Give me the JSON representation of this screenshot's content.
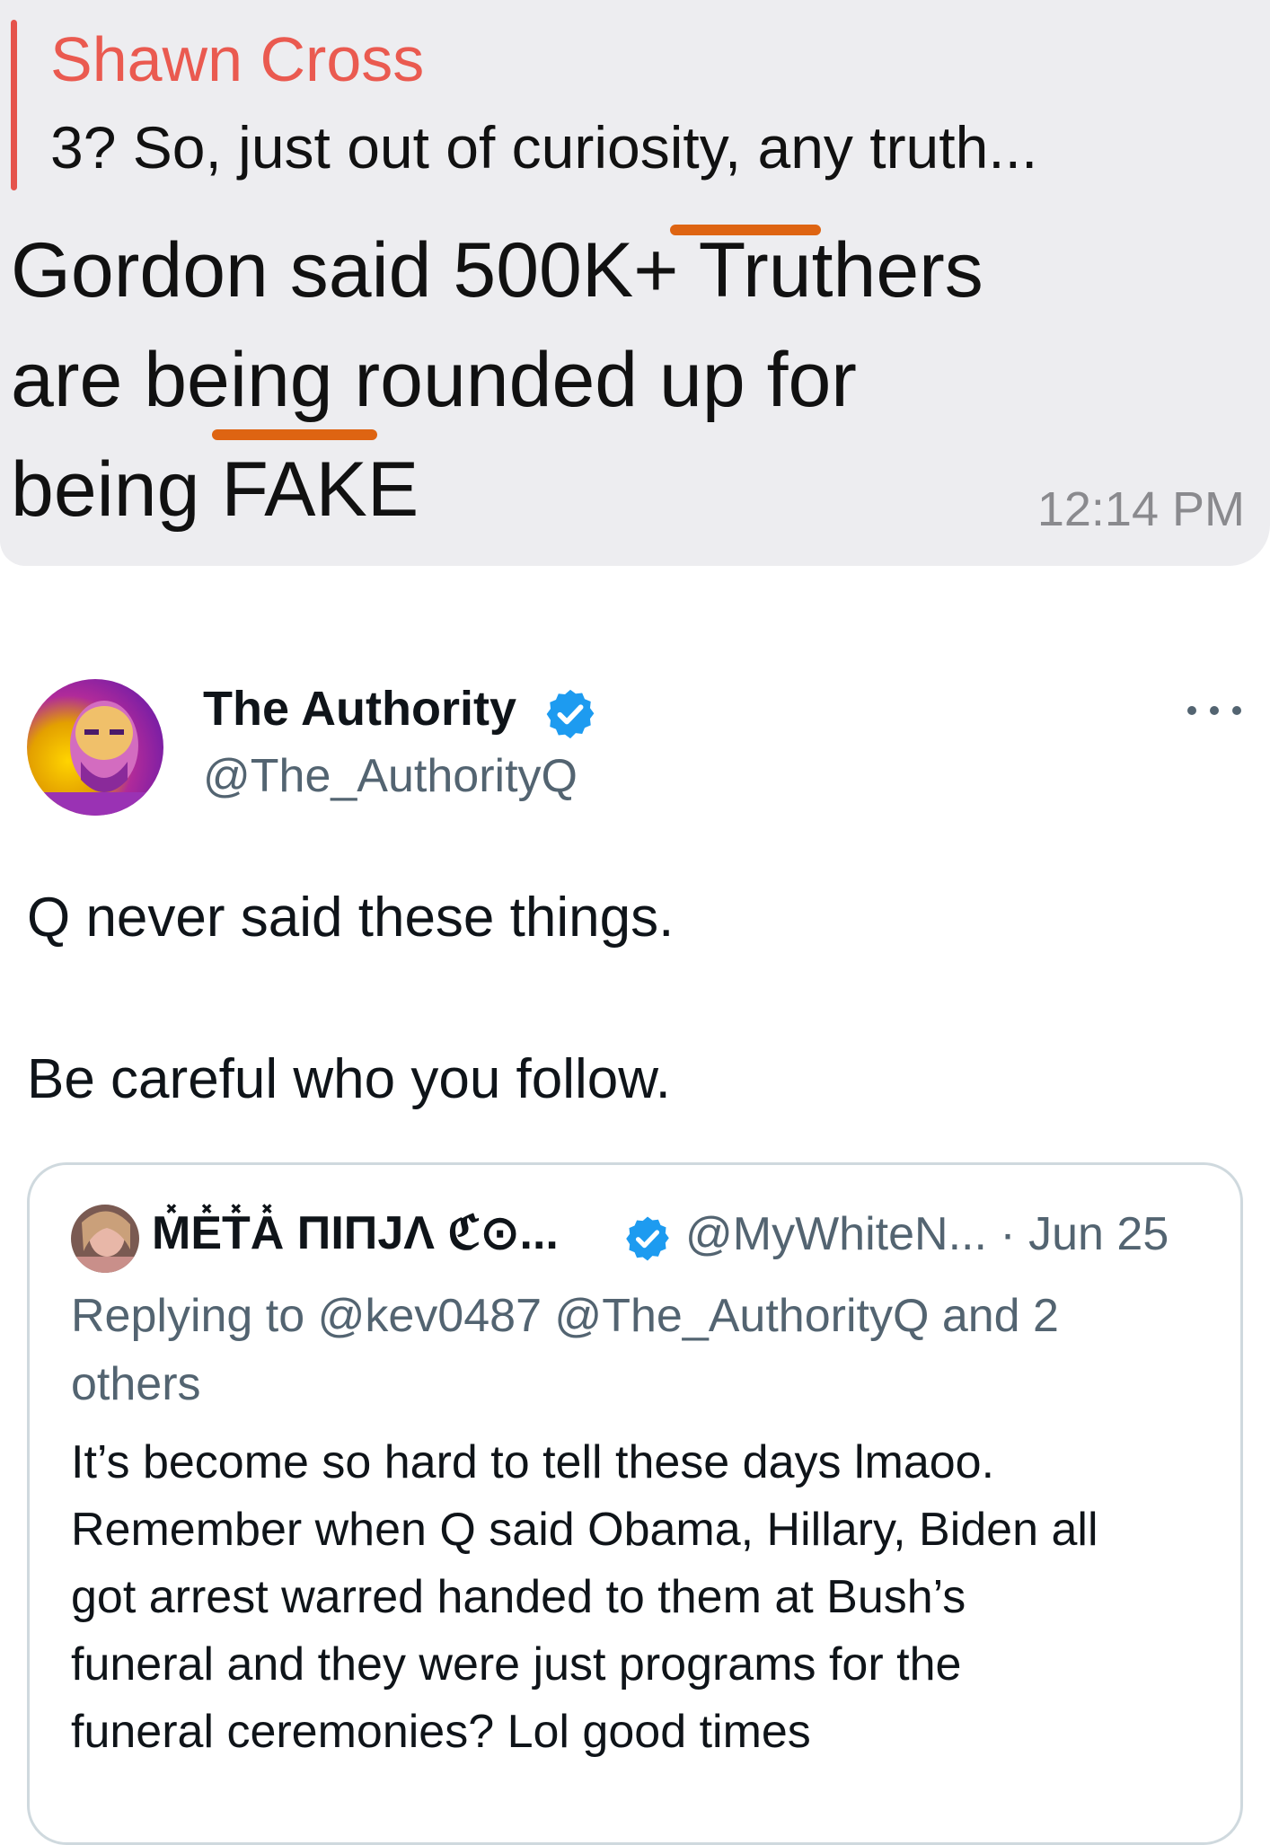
{
  "message": {
    "reply": {
      "sender": "Shawn Cross",
      "snippet": "3? So, just out of curiosity, any truth..."
    },
    "text_lines": [
      "Gordon said 500K+ Truthers",
      "are being rounded up for",
      "being FAKE"
    ],
    "time": "12:14 PM",
    "underline_color": "#de6412"
  },
  "tweet": {
    "author": {
      "name": "The Authority",
      "handle": "@The_AuthorityQ",
      "verified_icon": "verified-badge-icon"
    },
    "more_icon": "more-options-icon",
    "text_lines": [
      "Q never said these things.",
      "Be careful who you follow."
    ],
    "quote": {
      "author_name": "M̽E̽T̽A̽ ΠIΠJΛ ℭ⊙...",
      "author_handle_date": "@MyWhiteN... · Jun 25",
      "reply_lines": [
        "Replying to @kev0487 @The_AuthorityQ and 2",
        "others"
      ],
      "text_lines": [
        "It’s become so hard to tell these days lmaoo.",
        "Remember when Q said Obama, Hillary, Biden all",
        "got arrest warred handed to them at Bush’s",
        "funeral and they were just programs for the",
        "funeral ceremonies? Lol good times"
      ]
    }
  },
  "colors": {
    "bubble_bg": "#ededf0",
    "reply_accent": "#ea5a50",
    "verified_blue": "#1d9bf0",
    "secondary_text": "#536471"
  }
}
